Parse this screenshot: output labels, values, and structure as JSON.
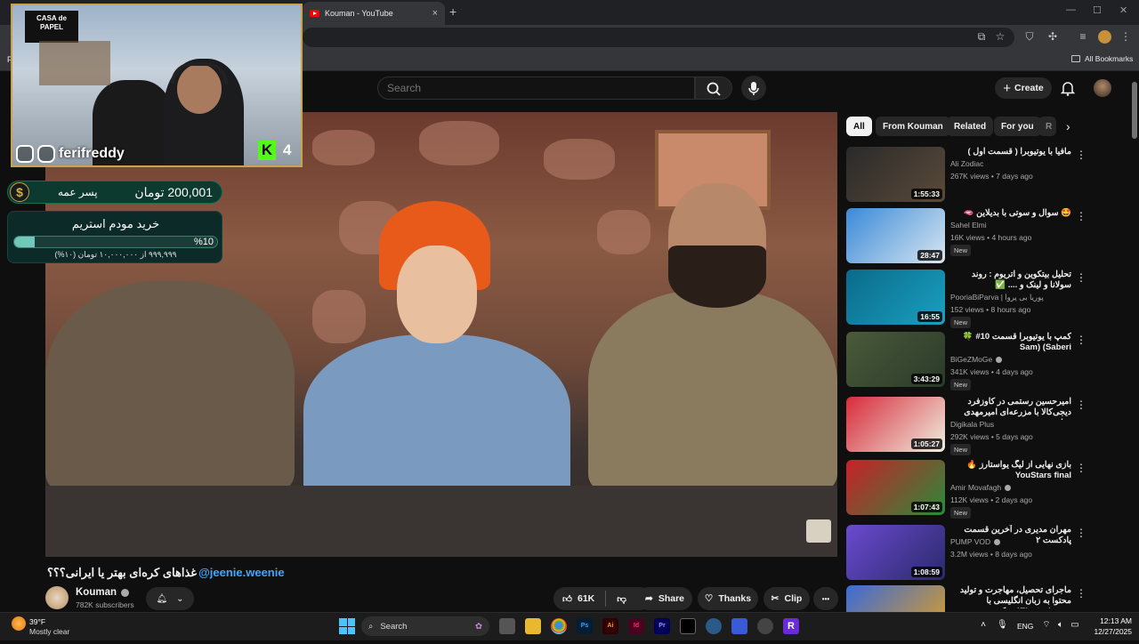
{
  "browser": {
    "tab_title": "Kouman - YouTube",
    "tab_close": "×",
    "new_tab": "+",
    "bookmarks_label": "All Bookmarks",
    "bookmark_left": "F",
    "window_buttons": [
      "—",
      "☐",
      "✕"
    ]
  },
  "youtube": {
    "search_placeholder": "Search",
    "create_label": "Create",
    "chips": [
      "All",
      "From Kouman",
      "Related",
      "For you",
      "R"
    ],
    "chip_next": "›"
  },
  "stream_overlay": {
    "casa_logo": "CASA de PAPEL",
    "handle": "ferifreddy",
    "kick_letter": "K",
    "kick_count": "4",
    "donor_name": "پسر عمه",
    "donation_amount": "200,001 تومان",
    "dollar_sign": "$",
    "goal_title": "خرید مودم استریم",
    "goal_percent_label": "%10",
    "goal_progress": 0.1,
    "goal_sub": "۹۹۹,۹۹۹ از ۱۰,۰۰۰,۰۰۰ تومان (۱۰%)"
  },
  "video": {
    "title_mention": "@jeenie.weenie",
    "title_text": "غذاهای کره‌ای بهتر یا ایرانی؟؟؟",
    "channel_name": "Kouman",
    "subscribers": "782K subscribers",
    "like_count": "61K",
    "share_label": "Share",
    "thanks_label": "Thanks",
    "clip_label": "Clip",
    "more_label": "•••"
  },
  "recommendations": [
    {
      "title": "مافیا با یوتیوبرا ( قسمت اول )",
      "channel": "Ali Zodiac",
      "meta": "267K views • 7 days ago",
      "duration": "1:55:33",
      "new": "",
      "verified": false,
      "thumb": [
        "#2a2a2a",
        "#5a4a3a"
      ]
    },
    {
      "title": "🤩 سوال و سوتی با بدیلاین 🫦",
      "channel": "Sahel Elmi",
      "meta": "16K views • 4 hours ago",
      "duration": "28:47",
      "new": "New",
      "verified": false,
      "thumb": [
        "#3a8ad8",
        "#d8e6f0"
      ]
    },
    {
      "title": "تحلیل بیتکوین و اتریوم : روند سولانا و لینک و .... ✅",
      "channel": "PooriaBiParva | پوریا بی پروا",
      "meta": "152 views • 8 hours ago",
      "duration": "16:55",
      "new": "New",
      "verified": false,
      "thumb": [
        "#0a6a8a",
        "#1aa0c0"
      ]
    },
    {
      "title": "کمپ با یوتیوبرا قسمت 10# 🍀 Sam) (Saberi",
      "channel": "BiGeZMoGe",
      "meta": "341K views • 4 days ago",
      "duration": "3:43:29",
      "new": "New",
      "verified": true,
      "thumb": [
        "#4a5a3a",
        "#2a3a2a"
      ]
    },
    {
      "title": "امیرحسین رستمی در کاوزفرد دیجی‌کالا با مزرعه‌ای امیرمهدی ژوله",
      "channel": "Digikala Plus",
      "meta": "292K views • 5 days ago",
      "duration": "1:05:27",
      "new": "New",
      "verified": false,
      "thumb": [
        "#d82a3a",
        "#f0f0e0"
      ]
    },
    {
      "title": "بازی نهایی از لیگ یواستارز 🔥 YouStars final",
      "channel": "Amir Movafagh",
      "meta": "112K views • 2 days ago",
      "duration": "1:07:43",
      "new": "New",
      "verified": true,
      "thumb": [
        "#c8202a",
        "#2a8a3a"
      ]
    },
    {
      "title": "مهران مدیری در آخرین قسمت پادکست ۲",
      "channel": "PUMP VOD",
      "meta": "3.2M views • 8 days ago",
      "duration": "1:08:59",
      "new": "",
      "verified": true,
      "thumb": [
        "#6a4ad0",
        "#2a2a6a"
      ]
    },
    {
      "title": "ماجرای تحصیل، مهاجرت و تولید محتوا به زبان انگلیسی با Electroboom! - دکو",
      "channel": "",
      "meta": "",
      "duration": "",
      "new": "",
      "verified": false,
      "thumb": [
        "#3a6ad8",
        "#e0a020"
      ]
    }
  ],
  "taskbar": {
    "temperature": "39°F",
    "weather": "Mostly clear",
    "search_label": "Search",
    "language": "ENG",
    "time": "12:13 AM",
    "date": "12/27/2025",
    "apps": [
      "Ps",
      "Ai",
      "Id",
      "Pr"
    ]
  }
}
